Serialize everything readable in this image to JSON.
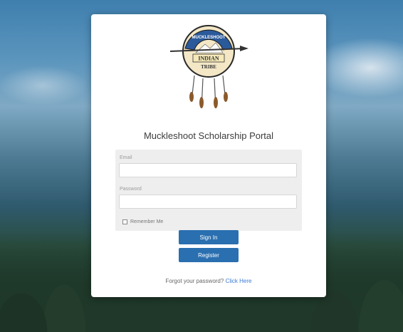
{
  "portal": {
    "title": "Muckleshoot Scholarship Portal",
    "logo": {
      "icon": "muckleshoot-dreamcatcher-logo",
      "top_text": "MUCKLESHOOT",
      "middle_text": "INDIAN",
      "bottom_text": "TRIBE"
    }
  },
  "form": {
    "email_label": "Email",
    "email_value": "",
    "password_label": "Password",
    "password_value": "",
    "remember_label": "Remember Me",
    "remember_checked": false
  },
  "buttons": {
    "signin_label": "Sign In",
    "register_label": "Register"
  },
  "footer": {
    "forgot_text": "Forgot your password?",
    "link_text": "Click Here"
  },
  "colors": {
    "button": "#2a6fb0",
    "link": "#3a7bd5",
    "card": "#ffffff",
    "form_box": "#eeeeee"
  }
}
